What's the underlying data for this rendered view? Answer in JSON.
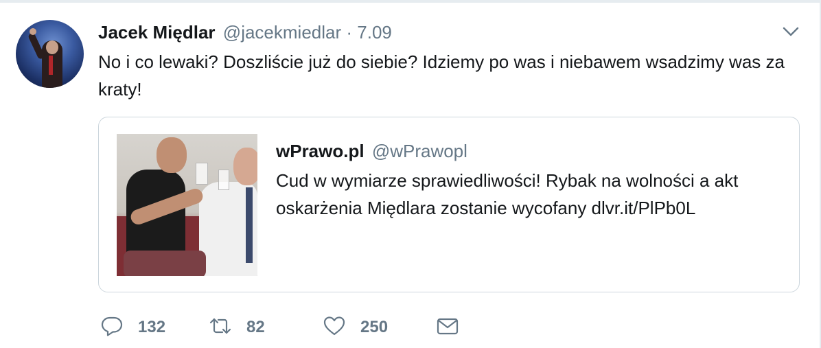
{
  "tweet": {
    "author_name": "Jacek Międlar",
    "author_handle": "@jacekmiedlar",
    "separator": "·",
    "date": "7.09",
    "text": "No i co lewaki? Doszliście już do siebie? Idziemy po was i niebawem wsadzimy was za kraty!",
    "menu_icon": "chevron-down-icon"
  },
  "quoted": {
    "author_name": "wPrawo.pl",
    "author_handle": "@wPrawopl",
    "text": "Cud w wymiarze sprawiedliwości! Rybak na wolności a akt oskarżenia Międlara zostanie wycofany dlvr.it/PlPb0L"
  },
  "actions": {
    "reply_count": "132",
    "retweet_count": "82",
    "like_count": "250"
  },
  "colors": {
    "text": "#14171a",
    "secondary": "#657786",
    "border": "#ccd6dd"
  }
}
